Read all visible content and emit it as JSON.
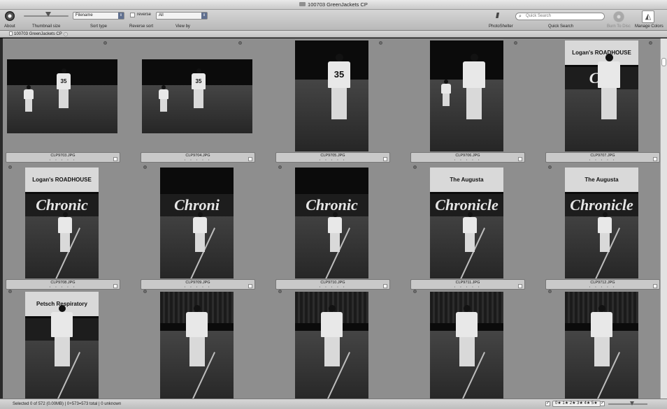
{
  "window": {
    "title": "100703 GreenJackets CP"
  },
  "toolbar": {
    "about_label": "About",
    "thumbnail_size_label": "Thumbnail size",
    "sort_type_label": "Sort type",
    "sort_type_value": "Filename",
    "reverse_label": "reverse",
    "reverse_sort_label": "Reverse sort",
    "view_by_label": "View by",
    "view_by_value": "All",
    "photoshelter_label": "PhotoShelter",
    "quick_search_placeholder": "Quick Search",
    "quick_search_label": "Quick Search",
    "burn_to_disc_label": "Burn To Disc",
    "manage_colors_label": "Manage Colors"
  },
  "tabs": [
    {
      "label": "100703 GreenJackets CP"
    }
  ],
  "thumbnails": [
    {
      "filename": "CLP9703.JPG",
      "rating": "• • • • •",
      "number": "35",
      "sign": "",
      "wall": "",
      "banner": ""
    },
    {
      "filename": "CLP9704.JPG",
      "rating": "• • • • •",
      "number": "35",
      "sign": "",
      "wall": "",
      "banner": ""
    },
    {
      "filename": "CLP9705.JPG",
      "rating": "• • • • •",
      "number": "35",
      "sign": "",
      "wall": "",
      "banner": ""
    },
    {
      "filename": "CLP9706.JPG",
      "rating": "• • • • •",
      "number": "",
      "sign": "",
      "wall": "",
      "banner": ""
    },
    {
      "filename": "CLP9707.JPG",
      "rating": "• • • • •",
      "number": "",
      "sign": "Logan's ROADHOUSE",
      "wall": "Chr",
      "banner": ""
    },
    {
      "filename": "CLP9708.JPG",
      "rating": "• • • • •",
      "number": "",
      "sign": "Logan's ROADHOUSE",
      "wall": "Chronic",
      "banner": ""
    },
    {
      "filename": "CLP9709.JPG",
      "rating": "• • • • •",
      "number": "",
      "sign": "",
      "wall": "Chroni",
      "banner": ""
    },
    {
      "filename": "CLP9710.JPG",
      "rating": "• • • • •",
      "number": "",
      "sign": "",
      "wall": "Chronic",
      "banner": ""
    },
    {
      "filename": "CLP9711.JPG",
      "rating": "• • • • •",
      "number": "",
      "sign": "The Augusta",
      "wall": "Chronicle",
      "banner": ""
    },
    {
      "filename": "CLP9712.JPG",
      "rating": "• • • • •",
      "number": "",
      "sign": "The Augusta",
      "wall": "Chronicle",
      "banner": ""
    },
    {
      "filename": "",
      "rating": "",
      "number": "",
      "sign": "Petsch Respiratory",
      "wall": "icle",
      "banner": ""
    },
    {
      "filename": "",
      "rating": "",
      "number": "",
      "sign": "",
      "wall": "",
      "banner": ""
    },
    {
      "filename": "",
      "rating": "",
      "number": "",
      "sign": "",
      "wall": "",
      "banner": ""
    },
    {
      "filename": "",
      "rating": "",
      "number": "",
      "sign": "",
      "wall": "",
      "banner": ""
    },
    {
      "filename": "",
      "rating": "",
      "number": "",
      "sign": "",
      "wall": "",
      "banner": ""
    }
  ],
  "status": {
    "text": "Selected 0 of 572 (0.00MB) | 0+573=573 total | 0 unknown",
    "rating_filter": "0★ 1★ 2★ 3★ 4★ 5★"
  }
}
